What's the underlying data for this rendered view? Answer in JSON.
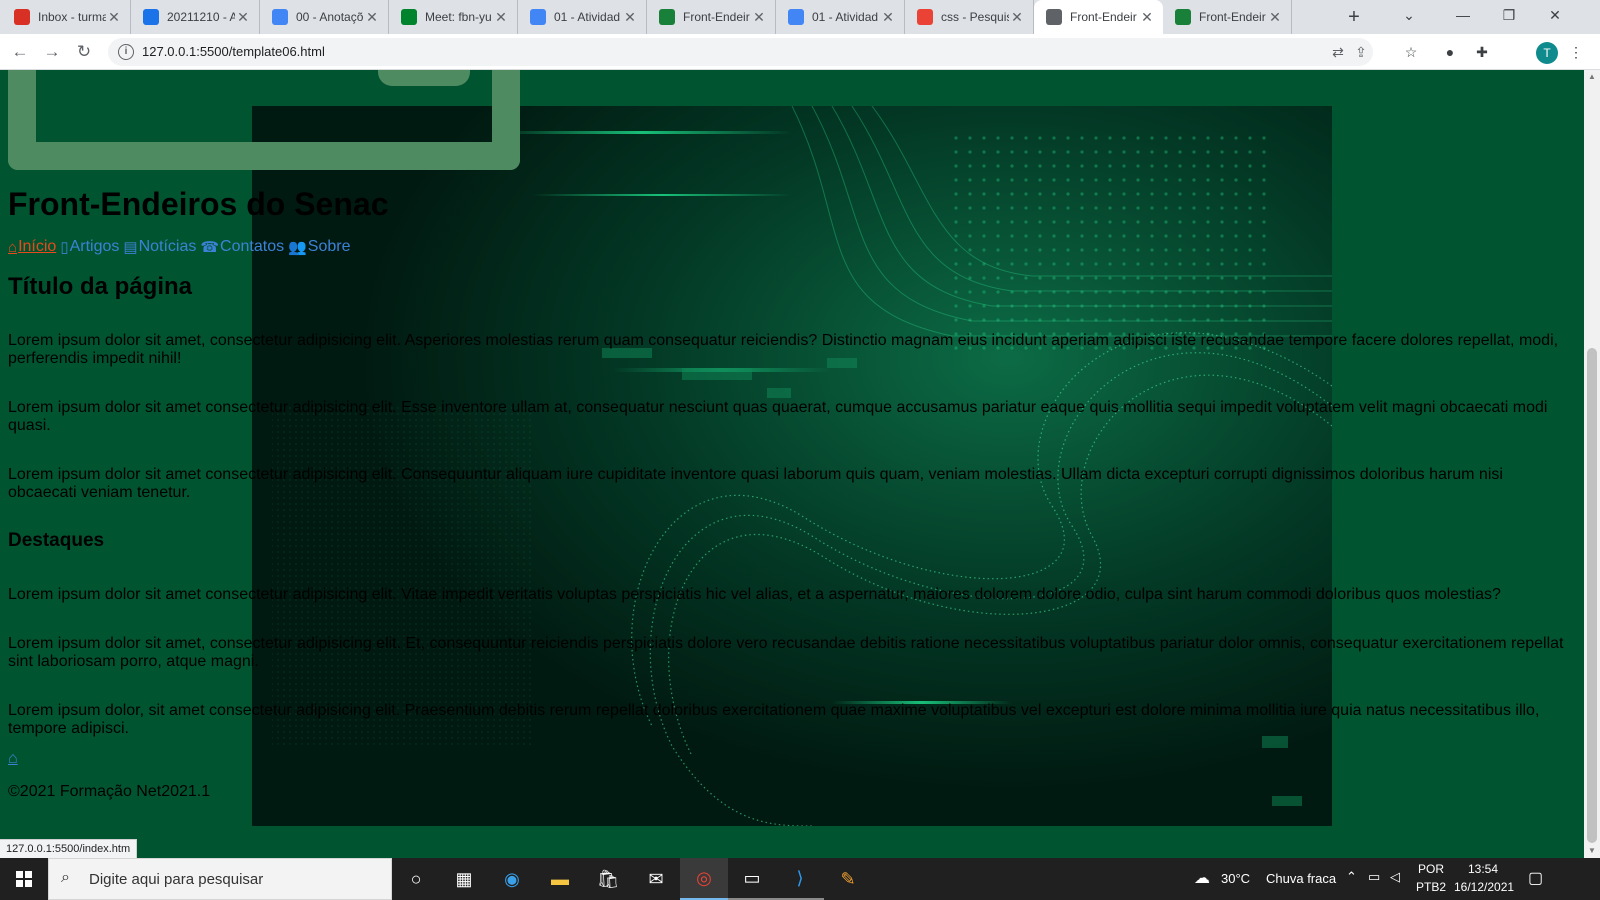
{
  "browser": {
    "tabs": [
      {
        "title": "Inbox - turma",
        "favicon": "gmail-icon",
        "color": "#d93025"
      },
      {
        "title": "20211210 - A",
        "favicon": "drive-icon",
        "color": "#1a73e8"
      },
      {
        "title": "00 - Anotaçõ",
        "favicon": "docs-icon",
        "color": "#4285f4"
      },
      {
        "title": "Meet: fbn-yu",
        "favicon": "meet-icon",
        "color": "#00832d"
      },
      {
        "title": "01 - Atividad",
        "favicon": "docs-icon",
        "color": "#4285f4"
      },
      {
        "title": "Front-Endeir",
        "favicon": "sheet-icon",
        "color": "#188038"
      },
      {
        "title": "01 - Atividad",
        "favicon": "docs-icon",
        "color": "#4285f4"
      },
      {
        "title": "css - Pesquis",
        "favicon": "google-icon",
        "color": "#ea4335"
      },
      {
        "title": "Front-Endeir",
        "favicon": "globe-icon",
        "color": "#5f6368"
      },
      {
        "title": "Front-Endeir",
        "favicon": "sheet-icon",
        "color": "#188038"
      }
    ],
    "active_tab_index": 8,
    "url": "127.0.0.1:5500/template06.html",
    "profile_initial": "T",
    "status_url": "127.0.0.1:5500/index.htm"
  },
  "page": {
    "site_title": "Front-Endeiros do Senac",
    "menu": [
      {
        "label": "Início",
        "icon": "home-icon",
        "current": true
      },
      {
        "label": "Artigos",
        "icon": "file-icon",
        "current": false
      },
      {
        "label": "Notícias",
        "icon": "newspaper-icon",
        "current": false
      },
      {
        "label": "Contatos",
        "icon": "phone-icon",
        "current": false
      },
      {
        "label": "Sobre",
        "icon": "users-icon",
        "current": false
      }
    ],
    "page_title": "Título da página",
    "paragraphs": [
      "Lorem ipsum dolor sit amet, consectetur adipisicing elit. Asperiores molestias rerum quam consequatur reiciendis? Distinctio magnam eius incidunt aperiam adipisci iste recusandae tempore facere dolores repellat, modi, perferendis impedit nihil!",
      "Lorem ipsum dolor sit amet consectetur adipisicing elit. Esse inventore ullam at, consequatur nesciunt quas quaerat, cumque accusamus pariatur eaque quis mollitia sequi impedit voluptatem velit magni obcaecati modi quasi.",
      "Lorem ipsum dolor sit amet consectetur adipisicing elit. Consequuntur aliquam iure cupiditate inventore quasi laborum quis quam, veniam molestias. Ullam dicta excepturi corrupti dignissimos doloribus harum nisi obcaecati veniam tenetur."
    ],
    "section_title": "Destaques",
    "highlights": [
      "Lorem ipsum dolor sit amet consectetur adipisicing elit. Vitae impedit veritatis voluptas perspiciatis hic vel alias, et a aspernatur, maiores dolorem dolore odio, culpa sint harum commodi doloribus quos molestias?",
      "Lorem ipsum dolor sit amet, consectetur adipisicing elit. Et, consequuntur reiciendis perspiciatis dolore vero recusandae debitis ratione necessitatibus voluptatibus pariatur dolor omnis, consequatur exercitationem repellat sint laboriosam porro, atque magni.",
      "Lorem ipsum dolor, sit amet consectetur adipisicing elit. Praesentium debitis rerum repellat doloribus exercitationem quae maxime voluptatibus vel excepturi est dolore minima mollitia iure quia natus necessitatibus illo, tempore adipisci."
    ],
    "copyright": "©2021 Formação Net2021.1"
  },
  "taskbar": {
    "search_placeholder": "Digite aqui para pesquisar",
    "weather_temp": "30°C",
    "weather_desc": "Chuva fraca",
    "lang_top": "POR",
    "lang_bottom": "PTB2",
    "time": "13:54",
    "date": "16/12/2021"
  },
  "colors": {
    "page_background": "#005530",
    "link": "#3b82d6",
    "active_link": "#e8491d"
  }
}
